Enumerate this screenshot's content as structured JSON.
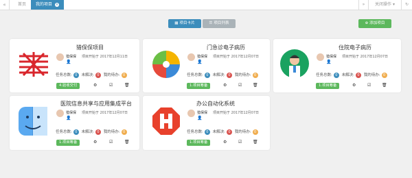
{
  "tabs": {
    "home": "首页",
    "current": "我的项目",
    "close_ops": "关闭操作"
  },
  "toolbar": {
    "card_view": "项目卡片",
    "list_view": "项目列表",
    "add_project": "添加项目"
  },
  "colors": {
    "primary": "#3c8dbc",
    "success": "#5cb85c",
    "gray": "#aab3b8",
    "danger": "#d9534f",
    "warning": "#f0ad4e"
  },
  "projects": [
    {
      "title": "猎保保项目",
      "owner": "猎保保",
      "start": "项目开始于 2017年12月11日",
      "total_label": "任务总数:",
      "total": "0",
      "unresolved_label": "未解决:",
      "unresolved": "0",
      "pending_label": "我的待办:",
      "pending": "0",
      "status": "4.验收交付",
      "status_color": "#5cb85c",
      "logo": "red-knot-logo"
    },
    {
      "title": "门急诊电子病历",
      "owner": "猎保保",
      "start": "项目开始于 2017年12月07日",
      "total_label": "任务总数:",
      "total": "0",
      "unresolved_label": "未解决:",
      "unresolved": "0",
      "pending_label": "我的待办:",
      "pending": "0",
      "status": "1.项目筹备",
      "status_color": "#5cb85c",
      "logo": "color-wheel-logo"
    },
    {
      "title": "住院电子病历",
      "owner": "猎保保",
      "start": "项目开始于 2017年12月07日",
      "total_label": "任务总数:",
      "total": "0",
      "unresolved_label": "未解决:",
      "unresolved": "0",
      "pending_label": "我的待办:",
      "pending": "0",
      "status": "1.项目筹备",
      "status_color": "#5cb85c",
      "logo": "doctor-logo"
    },
    {
      "title": "医院信息共享与应用集成平台",
      "owner": "猎保保",
      "start": "项目开始于 2017年12月07日",
      "total_label": "任务总数:",
      "total": "0",
      "unresolved_label": "未解决:",
      "unresolved": "0",
      "pending_label": "我的待办:",
      "pending": "0",
      "status": "1.项目筹备",
      "status_color": "#5cb85c",
      "logo": "finder-face-logo"
    },
    {
      "title": "办公自动化系统",
      "owner": "猎保保",
      "start": "项目开始于 2017年12月07日",
      "total_label": "任务总数:",
      "total": "0",
      "unresolved_label": "未解决:",
      "unresolved": "0",
      "pending_label": "我的待办:",
      "pending": "0",
      "status": "1.项目筹备",
      "status_color": "#5cb85c",
      "logo": "red-h-logo"
    }
  ]
}
